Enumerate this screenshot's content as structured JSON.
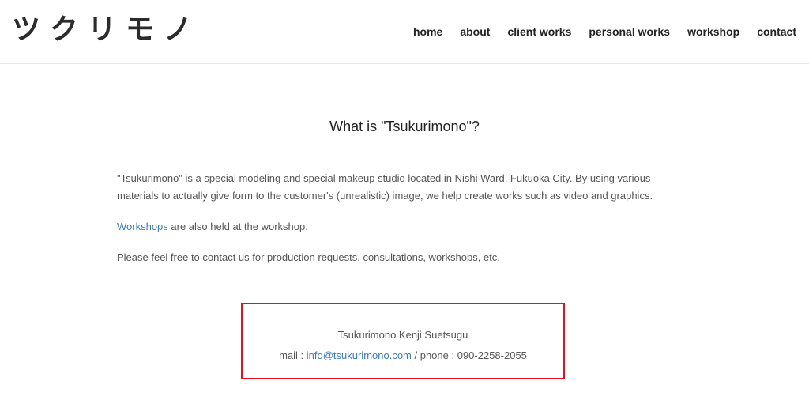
{
  "logo": {
    "text": "ツクリモノ"
  },
  "nav": {
    "items": [
      {
        "label": "home"
      },
      {
        "label": "about"
      },
      {
        "label": "client works"
      },
      {
        "label": "personal works"
      },
      {
        "label": "workshop"
      },
      {
        "label": "contact"
      }
    ],
    "active": "about"
  },
  "page": {
    "title": "What is \"Tsukurimono\"?",
    "paragraph1": "\"Tsukurimono\" is a special modeling and special makeup studio located in Nishi Ward, Fukuoka City. By using various materials to actually give form to the customer's (unrealistic) image, we help create works such as video and graphics.",
    "paragraph2_link": "Workshops",
    "paragraph2_rest": " are also held at the workshop.",
    "paragraph3": "Please feel free to contact us for production requests, consultations, workshops, etc."
  },
  "contact": {
    "name": "Tsukurimono Kenji Suetsugu",
    "mail_label": "mail : ",
    "email": "info@tsukurimono.com",
    "phone_label": " / phone : ",
    "phone": "090-2258-2055"
  },
  "colors": {
    "link": "#3b7bbf",
    "highlight_border": "#e8101b"
  }
}
